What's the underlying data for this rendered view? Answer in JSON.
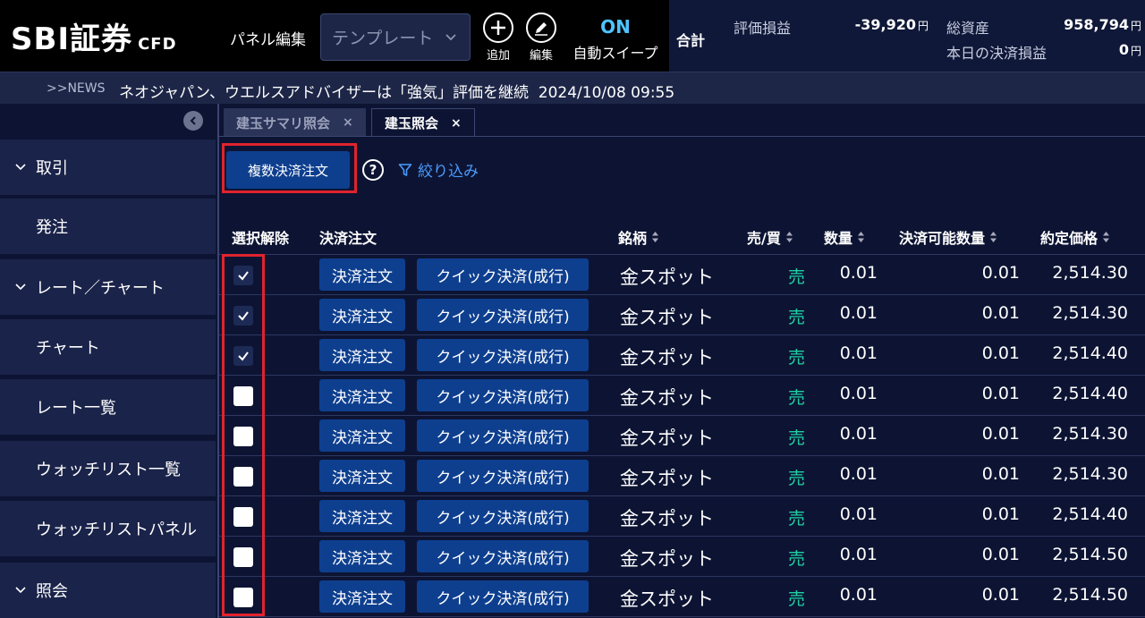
{
  "header": {
    "logo_main": "SBI証券",
    "logo_sub": "CFD",
    "panel_edit_label": "パネル編集",
    "template_select_value": "テンプレート",
    "add_label": "追加",
    "edit_label": "編集",
    "auto_sweep_state": "ON",
    "auto_sweep_label": "自動スイープ",
    "summary_title": "合計",
    "valuation_pl_label": "評価損益",
    "valuation_pl_value": "-39,920",
    "valuation_pl_unit": "円",
    "total_assets_label": "総資産",
    "total_assets_value": "958,794",
    "total_assets_unit": "円",
    "today_settle_pl_label": "本日の決済損益",
    "today_settle_pl_value": "0",
    "today_settle_pl_unit": "円"
  },
  "news": {
    "tag": ">>NEWS",
    "text": "ネオジャパン、ウエルスアドバイザーは「強気」評価を継続",
    "datetime": "2024/10/08 09:55"
  },
  "sidebar": {
    "items": [
      {
        "label": "取引",
        "type": "group"
      },
      {
        "label": "発注",
        "type": "sub"
      },
      {
        "label": "レート／チャート",
        "type": "group"
      },
      {
        "label": "チャート",
        "type": "sub"
      },
      {
        "label": "レート一覧",
        "type": "sub"
      },
      {
        "label": "ウォッチリスト一覧",
        "type": "sub"
      },
      {
        "label": "ウォッチリストパネル",
        "type": "sub"
      },
      {
        "label": "照会",
        "type": "group"
      }
    ]
  },
  "tabs": [
    {
      "label": "建玉サマリ照会",
      "close": "×",
      "active": false
    },
    {
      "label": "建玉照会",
      "close": "×",
      "active": true
    }
  ],
  "toolbar": {
    "multi_settle_label": "複数決済注文",
    "help_label": "?",
    "filter_label": "絞り込み"
  },
  "table": {
    "headers": {
      "select": "選択解除",
      "settle": "決済注文",
      "symbol": "銘柄",
      "side": "売/買",
      "qty": "数量",
      "available": "決済可能数量",
      "price": "約定価格"
    },
    "settle_button_label": "決済注文",
    "quick_button_label": "クイック決済(成行)",
    "rows": [
      {
        "checked": true,
        "symbol": "金スポット",
        "side": "売",
        "qty": "0.01",
        "available": "0.01",
        "price": "2,514.30"
      },
      {
        "checked": true,
        "symbol": "金スポット",
        "side": "売",
        "qty": "0.01",
        "available": "0.01",
        "price": "2,514.30"
      },
      {
        "checked": true,
        "symbol": "金スポット",
        "side": "売",
        "qty": "0.01",
        "available": "0.01",
        "price": "2,514.40"
      },
      {
        "checked": false,
        "symbol": "金スポット",
        "side": "売",
        "qty": "0.01",
        "available": "0.01",
        "price": "2,514.40"
      },
      {
        "checked": false,
        "symbol": "金スポット",
        "side": "売",
        "qty": "0.01",
        "available": "0.01",
        "price": "2,514.30"
      },
      {
        "checked": false,
        "symbol": "金スポット",
        "side": "売",
        "qty": "0.01",
        "available": "0.01",
        "price": "2,514.30"
      },
      {
        "checked": false,
        "symbol": "金スポット",
        "side": "売",
        "qty": "0.01",
        "available": "0.01",
        "price": "2,514.40"
      },
      {
        "checked": false,
        "symbol": "金スポット",
        "side": "売",
        "qty": "0.01",
        "available": "0.01",
        "price": "2,514.50"
      },
      {
        "checked": false,
        "symbol": "金スポット",
        "side": "売",
        "qty": "0.01",
        "available": "0.01",
        "price": "2,514.50"
      }
    ]
  },
  "colors": {
    "accent_blue": "#0e3f8f",
    "sell_green": "#1fd1a5",
    "highlight_red": "#e0232e",
    "on_blue": "#4fc3ff"
  }
}
